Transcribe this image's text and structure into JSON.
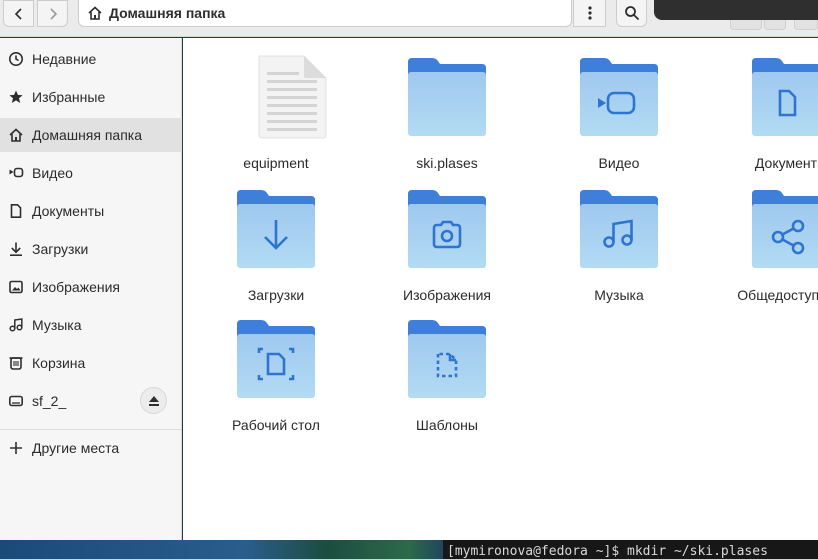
{
  "header": {
    "location": "Домашняя папка"
  },
  "sidebar": {
    "items": [
      {
        "label": "Недавние",
        "icon": "clock-icon"
      },
      {
        "label": "Избранные",
        "icon": "star-icon"
      },
      {
        "label": "Домашняя папка",
        "icon": "home-icon"
      },
      {
        "label": "Видео",
        "icon": "video-icon"
      },
      {
        "label": "Документы",
        "icon": "document-icon"
      },
      {
        "label": "Загрузки",
        "icon": "download-icon"
      },
      {
        "label": "Изображения",
        "icon": "image-icon"
      },
      {
        "label": "Музыка",
        "icon": "music-icon"
      },
      {
        "label": "Корзина",
        "icon": "trash-icon"
      },
      {
        "label": "sf_2_",
        "icon": "drive-icon"
      },
      {
        "label": "Другие места",
        "icon": "plus-icon"
      }
    ],
    "active": "Домашняя папка"
  },
  "files": [
    {
      "name": "equipment",
      "kind": "text-file"
    },
    {
      "name": "ski.plases",
      "kind": "folder"
    },
    {
      "name": "Видео",
      "kind": "video-folder"
    },
    {
      "name": "Документы",
      "kind": "documents-folder"
    },
    {
      "name": "Загрузки",
      "kind": "downloads-folder"
    },
    {
      "name": "Изображения",
      "kind": "pictures-folder"
    },
    {
      "name": "Музыка",
      "kind": "music-folder"
    },
    {
      "name": "Общедоступные",
      "kind": "public-folder"
    },
    {
      "name": "Рабочий стол",
      "kind": "desktop-folder"
    },
    {
      "name": "Шаблоны",
      "kind": "templates-folder"
    }
  ],
  "terminal": {
    "line": "[mymironova@fedora ~]$ mkdir ~/ski.plases"
  },
  "colors": {
    "folder_back": "#3d7fd9",
    "folder_front_top": "#9fc8f0",
    "folder_front_bottom": "#aed8f2",
    "folder_glyph": "#2f74cf"
  }
}
